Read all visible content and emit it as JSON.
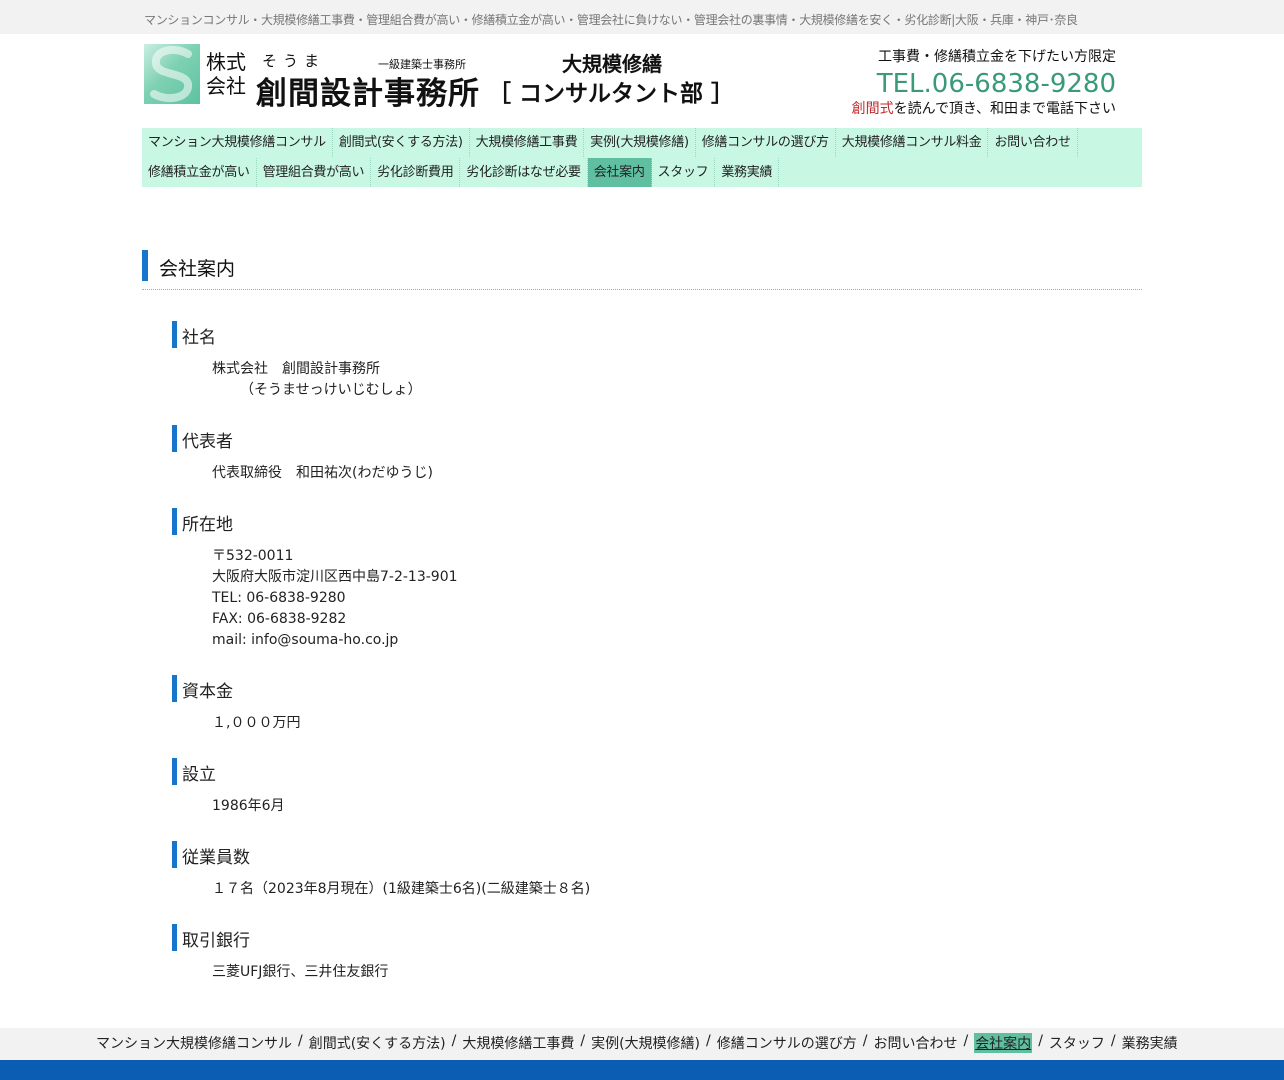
{
  "top_strip": {
    "text": "マンションコンサル・大規模修繕工事費・管理組合費が高い・修繕積立金が高い・管理会社に負けない・管理会社の裏事情・大規模修繕を安く・劣化診断|大阪・兵庫・神戸･奈良"
  },
  "logo": {
    "kabushiki": "株式",
    "kaisha": "会社",
    "kana": "そうま",
    "kyu": "一級建築士事務所",
    "name": "創間設計事務所",
    "big": "大規模修繕",
    "dept": "［ コンサルタント部 ］"
  },
  "contact": {
    "line1": "工事費・修繕積立金を下げたい方限定",
    "tel": "TEL.06-6838-9280",
    "line3_red": "創間式",
    "line3_rest": "を読んで頂き、和田まで電話下さい"
  },
  "nav": {
    "row1": [
      {
        "label": "マンション大規模修繕コンサル"
      },
      {
        "label": "創間式(安くする方法)"
      },
      {
        "label": "大規模修繕工事費"
      },
      {
        "label": "実例(大規模修繕)"
      },
      {
        "label": "修繕コンサルの選び方"
      },
      {
        "label": "大規模修繕コンサル料金"
      },
      {
        "label": "お問い合わせ"
      }
    ],
    "row2": [
      {
        "label": "修繕積立金が高い"
      },
      {
        "label": "管理組合費が高い"
      },
      {
        "label": "劣化診断費用"
      },
      {
        "label": "劣化診断はなぜ必要"
      },
      {
        "label": "会社案内",
        "active": true
      },
      {
        "label": "スタッフ"
      },
      {
        "label": "業務実績"
      }
    ]
  },
  "page_title": "会社案内",
  "sections": {
    "company": {
      "title": "社名",
      "line1": "株式会社　創間設計事務所",
      "line2": "（そうませっけいじむしょ）"
    },
    "rep": {
      "title": "代表者",
      "line1": "代表取締役　和田祐次(わだゆうじ)"
    },
    "address": {
      "title": "所在地",
      "zip": "〒532-0011",
      "addr": "大阪府大阪市淀川区西中島7-2-13-901",
      "tel": "TEL: 06-6838-9280",
      "fax": "FAX: 06-6838-9282",
      "mail": "mail: info@souma-ho.co.jp"
    },
    "capital": {
      "title": "資本金",
      "line1": "１,０００万円"
    },
    "founded": {
      "title": "設立",
      "line1": "1986年6月"
    },
    "employees": {
      "title": "従業員数",
      "line1": "１７名（2023年8月現在）(1級建築士6名)(二級建築士８名)"
    },
    "bank": {
      "title": "取引銀行",
      "line1": "三菱UFJ銀行、三井住友銀行"
    }
  },
  "footer_nav": {
    "items": [
      {
        "label": "マンション大規模修繕コンサル"
      },
      {
        "label": "創間式(安くする方法)"
      },
      {
        "label": "大規模修繕工事費"
      },
      {
        "label": "実例(大規模修繕)"
      },
      {
        "label": "修繕コンサルの選び方"
      },
      {
        "label": "お問い合わせ"
      },
      {
        "label": "会社案内",
        "active": true
      },
      {
        "label": "スタッフ"
      },
      {
        "label": "業務実績"
      }
    ],
    "separator": "/"
  },
  "colors": {
    "accent_blue": "#1676cc",
    "nav_bg": "#c8f8e4",
    "nav_active": "#5fbfa0",
    "tel_green": "#3a9a78",
    "footer_blue": "#0b5db3"
  }
}
